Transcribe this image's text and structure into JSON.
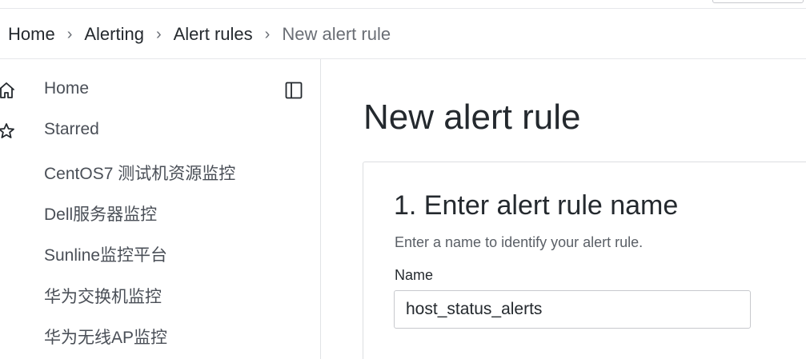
{
  "breadcrumb": {
    "items": [
      "Home",
      "Alerting",
      "Alert rules"
    ],
    "current": "New alert rule",
    "separator": "›"
  },
  "sidebar": {
    "items": [
      {
        "label": "Home",
        "icon": "home-icon"
      },
      {
        "label": "Starred",
        "icon": "star-icon"
      },
      {
        "label": "CentOS7 测试机资源监控"
      },
      {
        "label": "Dell服务器监控"
      },
      {
        "label": "Sunline监控平台"
      },
      {
        "label": "华为交换机监控"
      },
      {
        "label": "华为无线AP监控"
      }
    ],
    "dock_icon": "dock-sidebar-icon"
  },
  "main": {
    "title": "New alert rule",
    "section": {
      "title": "1. Enter alert rule name",
      "description": "Enter a name to identify your alert rule.",
      "name_label": "Name",
      "name_value": "host_status_alerts"
    }
  }
}
